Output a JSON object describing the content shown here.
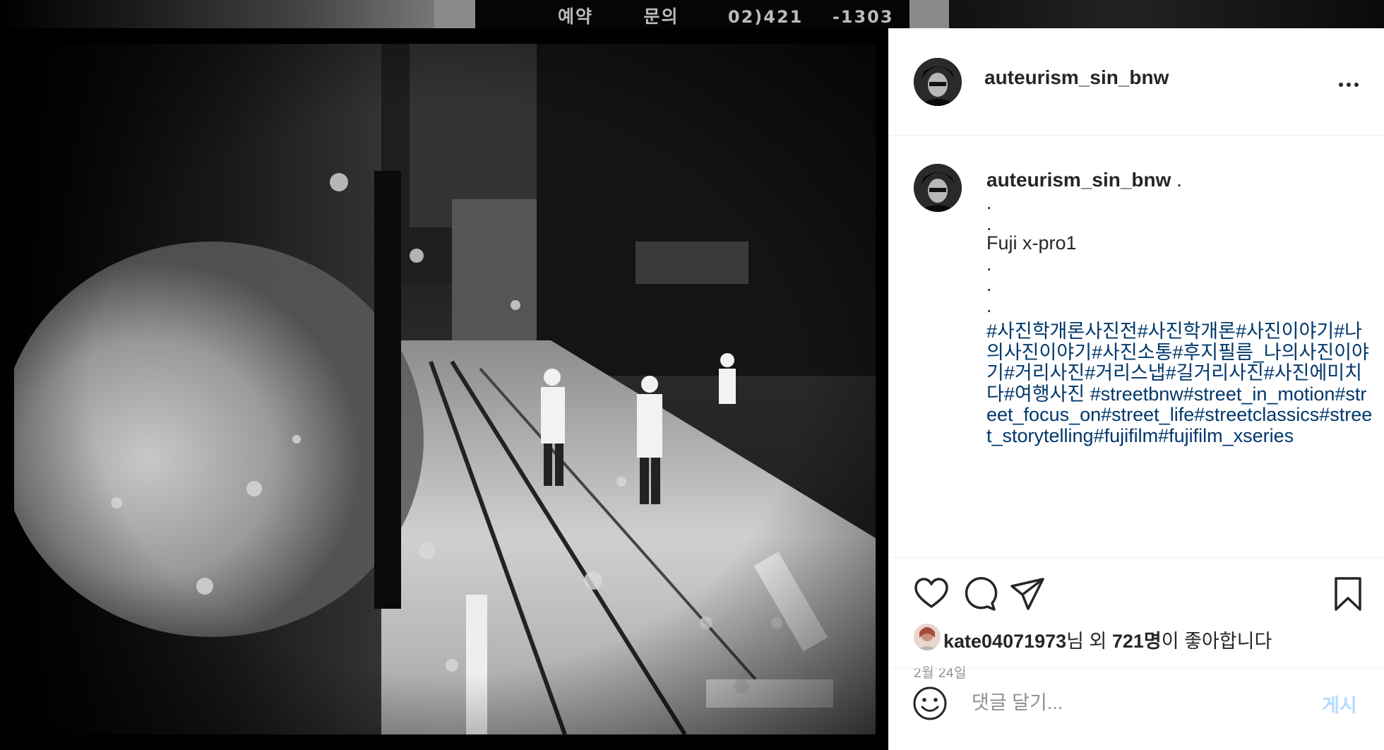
{
  "background_sign": {
    "text_1": "예약",
    "text_2": "문의",
    "text_3": "02)421",
    "text_4": "-1303"
  },
  "post": {
    "username": "auteurism_sin_bnw",
    "more_icon": "more-horizontal-icon",
    "caption": {
      "username": "auteurism_sin_bnw",
      "lines": [
        " .",
        ".",
        ".",
        "Fuji x-pro1",
        ".",
        ".",
        "."
      ],
      "hashtags": "#사진학개론사진전#사진학개론#사진이야기#나의사진이야기#사진소통#후지필름_나의사진이야기#거리사진#거리스냅#길거리사진#사진에미치다#여행사진 #streetbnw#street_in_motion#street_focus_on#street_life#streetclassics#street_storytelling#fujifilm#fujifilm_xseries"
    },
    "actions": {
      "like_icon": "heart-icon",
      "comment_icon": "comment-icon",
      "share_icon": "paper-plane-icon",
      "save_icon": "bookmark-icon"
    },
    "likes": {
      "user": "kate04071973",
      "text_mid": "님 외 ",
      "count": "721명",
      "text_end": "이 좋아합니다"
    },
    "date": "2월 24일",
    "comment": {
      "placeholder": "댓글 달기...",
      "post_label": "게시",
      "emoji_icon": "smiley-icon"
    }
  },
  "colors": {
    "hashtag": "#00376b",
    "text": "#262626",
    "muted": "#8e8e8e",
    "post_button_disabled": "#b3dbff"
  }
}
